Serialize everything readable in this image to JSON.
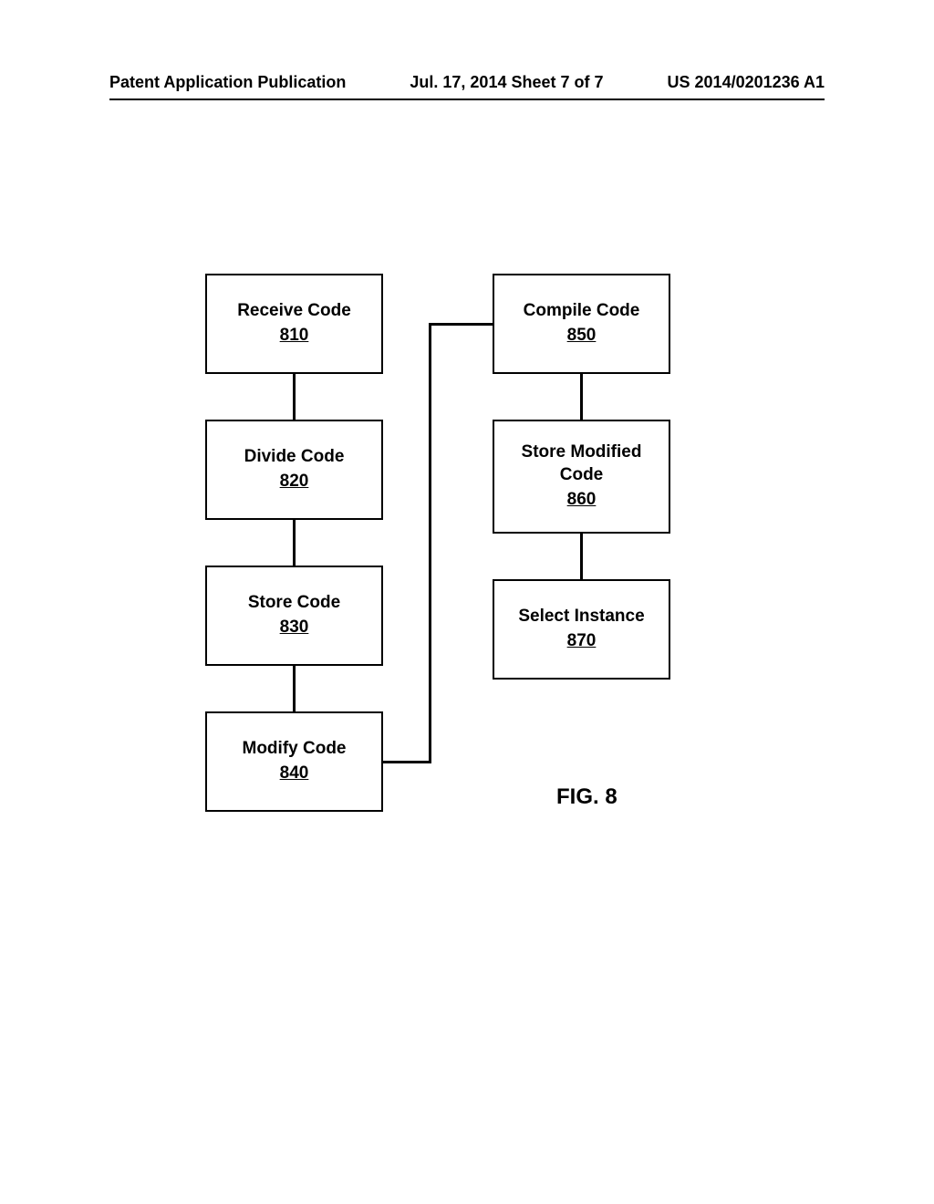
{
  "header": {
    "left": "Patent Application Publication",
    "center": "Jul. 17, 2014  Sheet 7 of 7",
    "right": "US 2014/0201236 A1"
  },
  "boxes": {
    "b810": {
      "title": "Receive Code",
      "num": "810"
    },
    "b820": {
      "title": "Divide Code",
      "num": "820"
    },
    "b830": {
      "title": "Store Code",
      "num": "830"
    },
    "b840": {
      "title": "Modify Code",
      "num": "840"
    },
    "b850": {
      "title": "Compile Code",
      "num": "850"
    },
    "b860_line1": "Store Modified",
    "b860_line2": "Code",
    "b860_num": "860",
    "b870": {
      "title": "Select Instance",
      "num": "870"
    }
  },
  "figure_label": "FIG. 8"
}
